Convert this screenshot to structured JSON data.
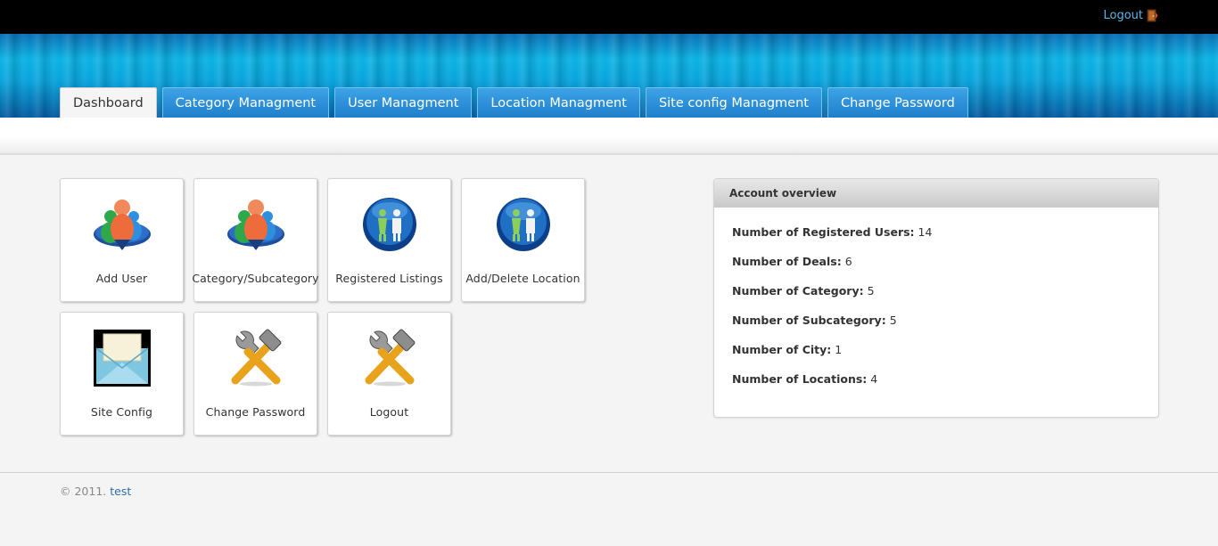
{
  "topbar": {
    "logout_label": "Logout",
    "logout_icon": "door-exit-icon"
  },
  "nav": {
    "tabs": [
      {
        "label": "Dashboard",
        "active": true
      },
      {
        "label": "Category Managment"
      },
      {
        "label": "User Managment"
      },
      {
        "label": "Location Managment"
      },
      {
        "label": "Site config Managment"
      },
      {
        "label": "Change Password"
      }
    ]
  },
  "tiles": [
    {
      "label": "Add User",
      "icon": "users-group-icon"
    },
    {
      "label": "Category/Subcategory",
      "icon": "users-group-icon"
    },
    {
      "label": "Registered Listings",
      "icon": "people-globe-icon"
    },
    {
      "label": "Add/Delete Location",
      "icon": "people-globe-icon"
    },
    {
      "label": "Site Config",
      "icon": "envelope-icon"
    },
    {
      "label": "Change Password",
      "icon": "tools-icon"
    },
    {
      "label": "Logout",
      "icon": "tools-icon"
    }
  ],
  "overview": {
    "title": "Account overview",
    "rows": [
      {
        "label": "Number of Registered Users:",
        "value": "14"
      },
      {
        "label": "Number of Deals:",
        "value": "6"
      },
      {
        "label": "Number of Category:",
        "value": "5"
      },
      {
        "label": "Number of Subcategory:",
        "value": "5"
      },
      {
        "label": "Number of City:",
        "value": "1"
      },
      {
        "label": "Number of Locations:",
        "value": "4"
      }
    ]
  },
  "footer": {
    "copyright": "© 2011.",
    "link": "test"
  },
  "colors": {
    "header_blue": "#0bb2e3",
    "tab_blue": "#1f7fcc",
    "link_blue": "#5ab8e6"
  }
}
